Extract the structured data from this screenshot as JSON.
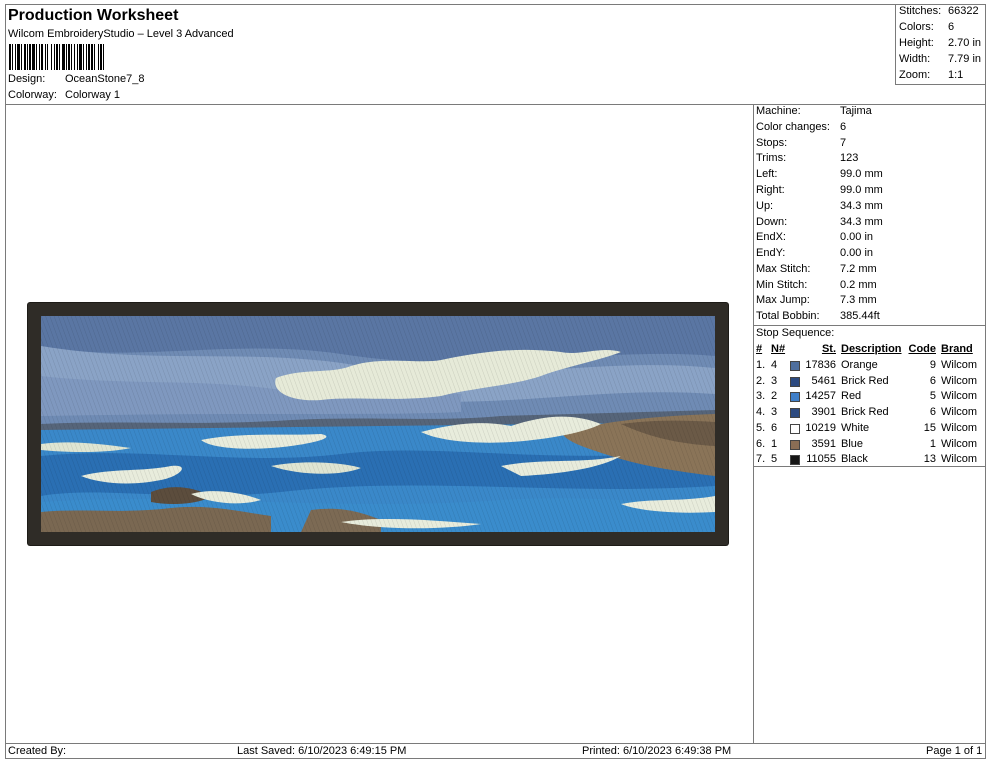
{
  "header": {
    "title": "Production Worksheet",
    "subtitle": "Wilcom EmbroideryStudio – Level 3 Advanced",
    "design_label": "Design:",
    "design_value": "OceanStone7_8",
    "colorway_label": "Colorway:",
    "colorway_value": "Colorway 1"
  },
  "summary": [
    {
      "label": "Stitches:",
      "value": "66322"
    },
    {
      "label": "Colors:",
      "value": "6"
    },
    {
      "label": "Height:",
      "value": "2.70 in"
    },
    {
      "label": "Width:",
      "value": "7.79 in"
    },
    {
      "label": "Zoom:",
      "value": "1:1"
    }
  ],
  "details": [
    {
      "label": "Machine:",
      "value": "Tajima"
    },
    {
      "label": "Color changes:",
      "value": "6"
    },
    {
      "label": "Stops:",
      "value": "7"
    },
    {
      "label": "Trims:",
      "value": "123"
    },
    {
      "label": "Left:",
      "value": "99.0 mm"
    },
    {
      "label": "Right:",
      "value": "99.0 mm"
    },
    {
      "label": "Up:",
      "value": "34.3 mm"
    },
    {
      "label": "Down:",
      "value": "34.3 mm"
    },
    {
      "label": "EndX:",
      "value": "0.00 in"
    },
    {
      "label": "EndY:",
      "value": "0.00 in"
    },
    {
      "label": "Max Stitch:",
      "value": "7.2 mm"
    },
    {
      "label": "Min Stitch:",
      "value": "0.2 mm"
    },
    {
      "label": "Max Jump:",
      "value": "7.3 mm"
    },
    {
      "label": "Total Bobbin:",
      "value": "385.44ft"
    }
  ],
  "stop_sequence": {
    "title": "Stop Sequence:",
    "headers": {
      "idx": "#",
      "n": "N#",
      "st": "St.",
      "desc": "Description",
      "code": "Code",
      "brand": "Brand"
    },
    "rows": [
      {
        "idx": "1.",
        "n": "4",
        "color": "#4f6f9e",
        "st": "17836",
        "desc": "Orange",
        "code": "9",
        "brand": "Wilcom"
      },
      {
        "idx": "2.",
        "n": "3",
        "color": "#2d4a80",
        "st": "5461",
        "desc": "Brick Red",
        "code": "6",
        "brand": "Wilcom"
      },
      {
        "idx": "3.",
        "n": "2",
        "color": "#3f7fc8",
        "st": "14257",
        "desc": "Red",
        "code": "5",
        "brand": "Wilcom"
      },
      {
        "idx": "4.",
        "n": "3",
        "color": "#2d4a80",
        "st": "3901",
        "desc": "Brick Red",
        "code": "6",
        "brand": "Wilcom"
      },
      {
        "idx": "5.",
        "n": "6",
        "color": "#ffffff",
        "st": "10219",
        "desc": "White",
        "code": "15",
        "brand": "Wilcom"
      },
      {
        "idx": "6.",
        "n": "1",
        "color": "#8a6e55",
        "st": "3591",
        "desc": "Blue",
        "code": "1",
        "brand": "Wilcom"
      },
      {
        "idx": "7.",
        "n": "5",
        "color": "#161616",
        "st": "11055",
        "desc": "Black",
        "code": "13",
        "brand": "Wilcom"
      }
    ]
  },
  "footer": {
    "created_by": "Created By:",
    "last_saved": "Last Saved: 6/10/2023 6:49:15 PM",
    "printed": "Printed: 6/10/2023 6:49:38 PM",
    "page": "Page 1 of 1"
  }
}
